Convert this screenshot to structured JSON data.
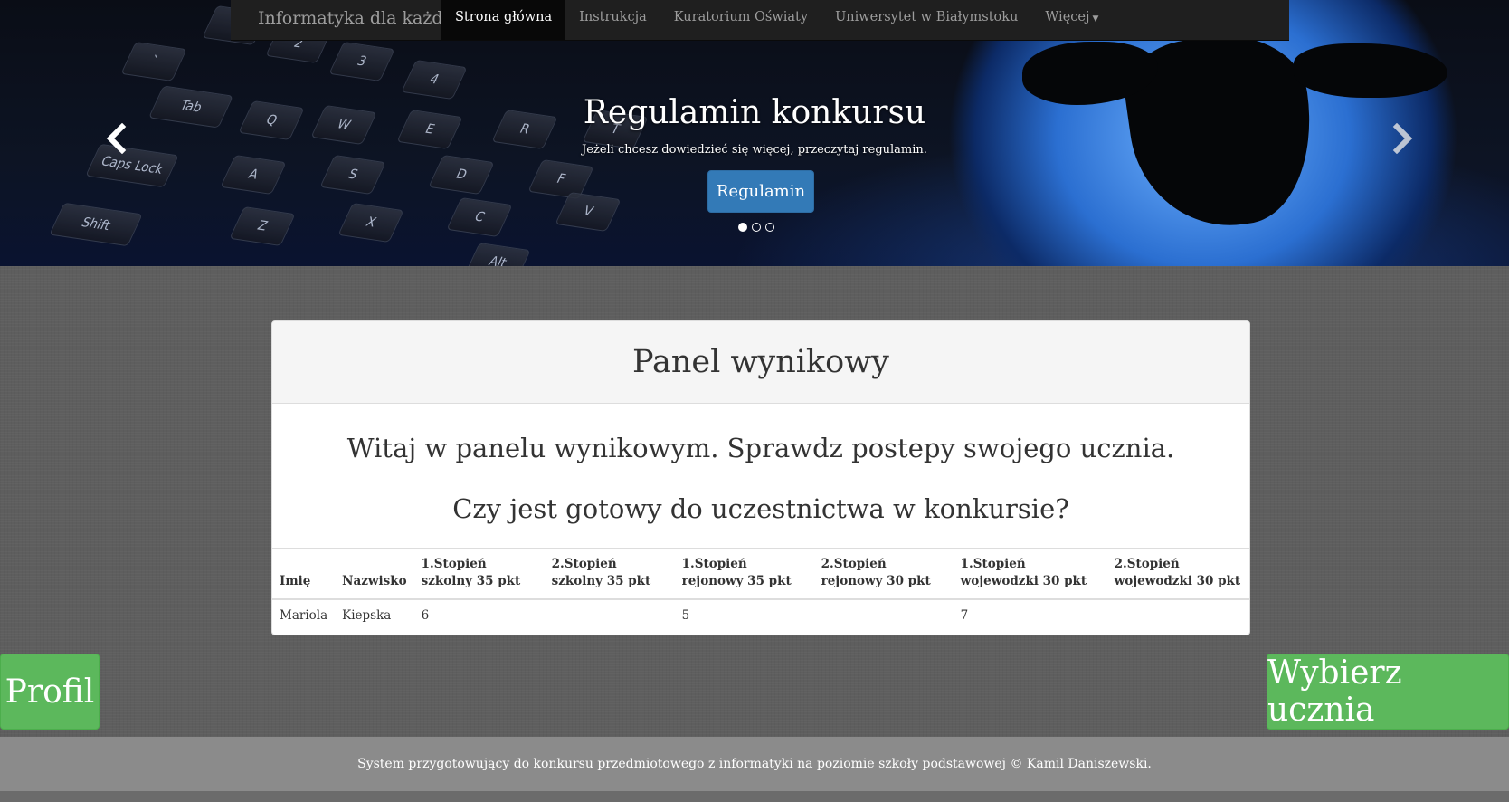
{
  "navbar": {
    "brand": "Informatyka dla każdego",
    "items": [
      {
        "label": "Strona główna",
        "active": true
      },
      {
        "label": "Instrukcja",
        "active": false
      },
      {
        "label": "Kuratorium Oświaty",
        "active": false
      },
      {
        "label": "Uniwersytet w Białymstoku",
        "active": false
      },
      {
        "label": "Więcej",
        "active": false,
        "dropdown": true
      }
    ]
  },
  "carousel": {
    "title": "Regulamin konkursu",
    "subtitle": "Jeżeli chcesz dowiedzieć się więcej, przeczytaj regulamin.",
    "button_label": "Regulamin",
    "slides_count": 3,
    "active_slide": 1,
    "prev_icon": "chevron-left-icon",
    "next_icon": "chevron-right-icon"
  },
  "panel": {
    "heading": "Panel wynikowy",
    "welcome": "Witaj w panelu wynikowym. Sprawdz postepy swojego ucznia.",
    "question": "Czy jest gotowy do uczestnictwa w konkursie?",
    "table": {
      "headers": [
        "Imię",
        "Nazwisko",
        "1.Stopień szkolny 35 pkt",
        "2.Stopień szkolny 35 pkt",
        "1.Stopień rejonowy 35 pkt",
        "2.Stopień rejonowy 30 pkt",
        "1.Stopień wojewodzki 30 pkt",
        "2.Stopień wojewodzki 30 pkt"
      ],
      "rows": [
        [
          "Mariola",
          "Kiepska",
          "6",
          "",
          "5",
          "",
          "7",
          ""
        ]
      ]
    }
  },
  "buttons": {
    "profile": "Profil",
    "choose_student": "Wybierz ucznia"
  },
  "footer": {
    "text": "System przygotowujący do konkursu przedmiotowego z informatyki na poziomie szkoły podstawowej © Kamil Daniszewski."
  },
  "colors": {
    "primary": "#337ab7",
    "success": "#5cb85c",
    "navbar": "#1f1f1f"
  }
}
